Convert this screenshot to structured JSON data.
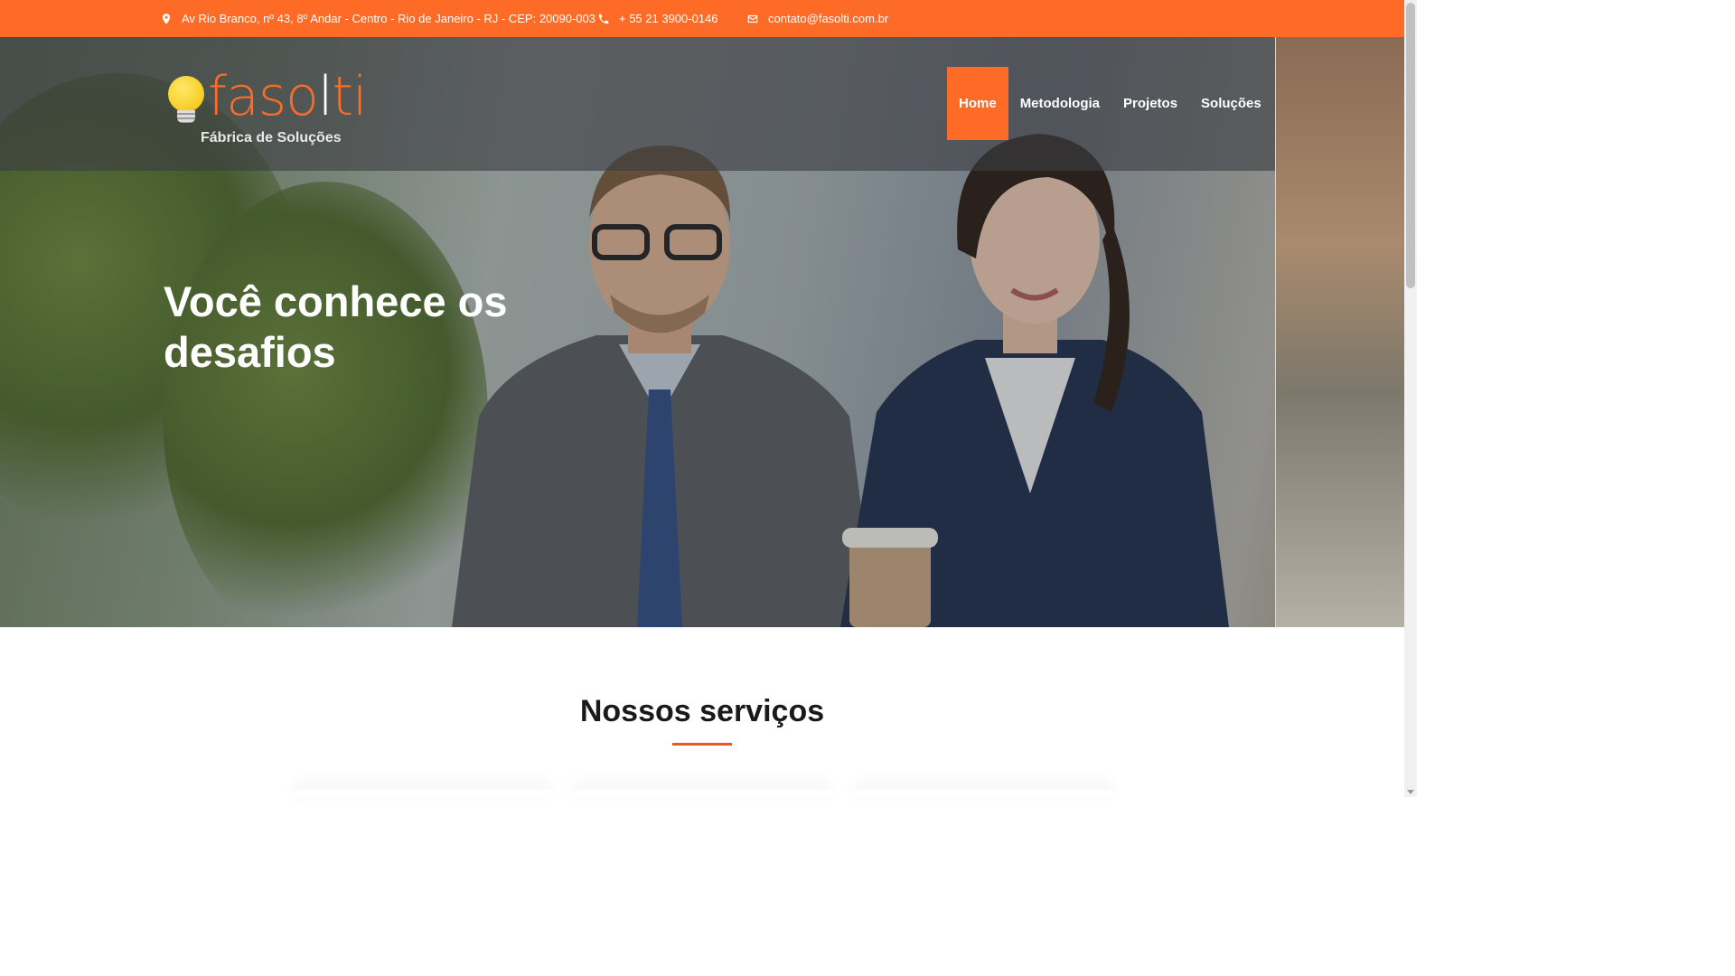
{
  "topbar": {
    "address": "Av Rio Branco, nº 43, 8º Andar - Centro - Rio de Janeiro - RJ - CEP: 20090-003",
    "phone": "+ 55 21 3900-0146",
    "email": "contato@fasolti.com.br",
    "icons": [
      "map-pin-icon",
      "phone-icon",
      "envelope-icon"
    ],
    "background_color": "#fe6b26"
  },
  "brand": {
    "name_part1": "faso",
    "name_part2": "l",
    "name_part3": "ti",
    "tagline": "Fábrica de Soluções",
    "accent_color": "#fe6b26"
  },
  "nav": {
    "items": [
      {
        "label": "Home",
        "active": true
      },
      {
        "label": "Metodologia",
        "active": false
      },
      {
        "label": "Projetos",
        "active": false
      },
      {
        "label": "Soluções",
        "active": false
      }
    ]
  },
  "hero": {
    "headline": "Você conhece os desafios"
  },
  "services": {
    "title": "Nossos serviços",
    "underline_color": "#e8572a"
  }
}
